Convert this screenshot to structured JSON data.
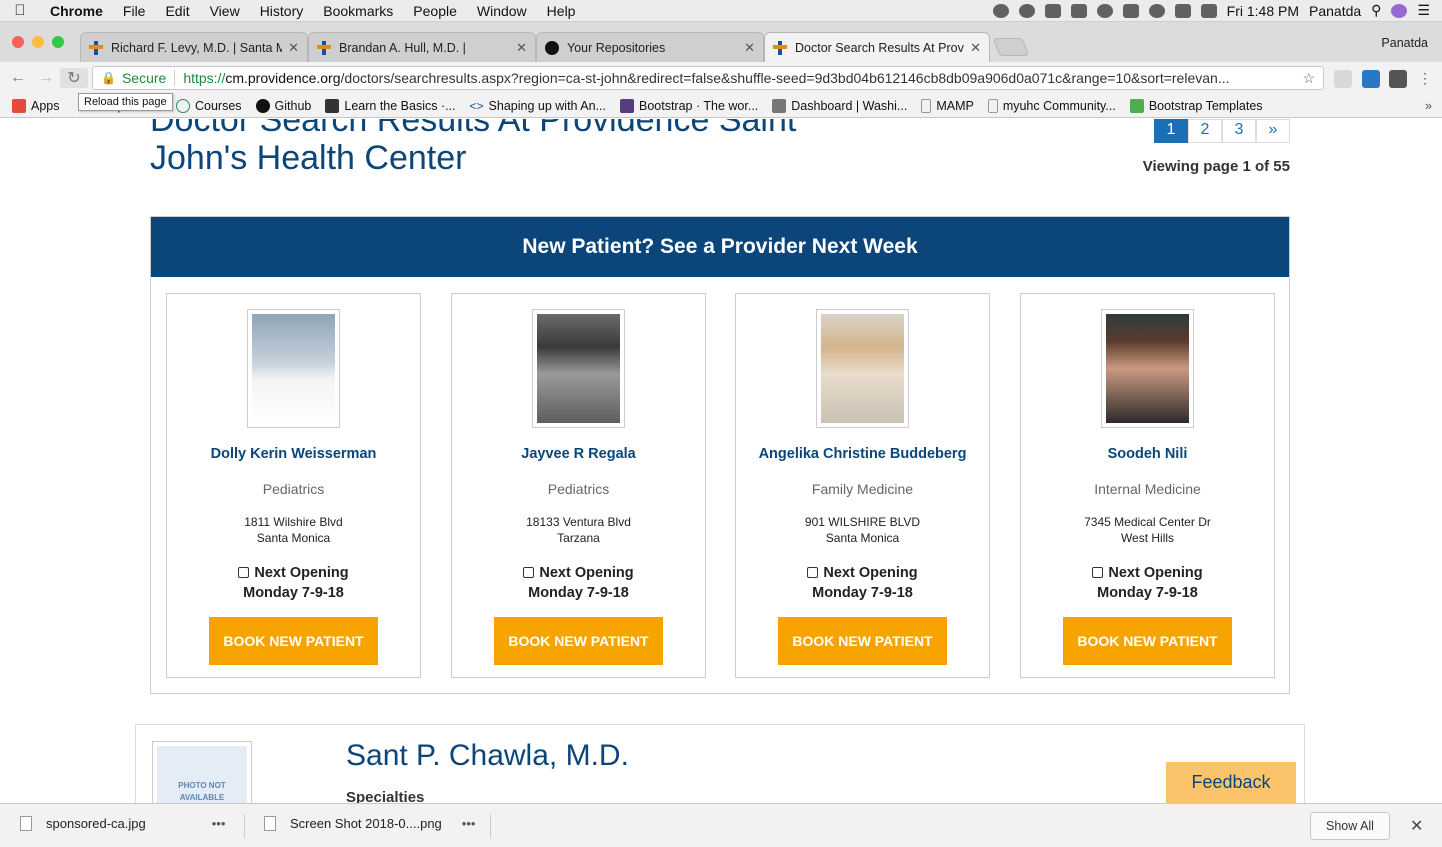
{
  "menubar": {
    "app": "Chrome",
    "items": [
      "File",
      "Edit",
      "View",
      "History",
      "Bookmarks",
      "People",
      "Window",
      "Help"
    ],
    "clock": "Fri 1:48 PM",
    "user": "Panatda"
  },
  "tabs": [
    {
      "title": "Richard F. Levy, M.D. | Santa M",
      "icon": "providence-icon"
    },
    {
      "title": "Brandan A. Hull, M.D. |",
      "icon": "providence-icon"
    },
    {
      "title": "Your Repositories",
      "icon": "github-icon"
    },
    {
      "title": "Doctor Search Results At Provi",
      "icon": "providence-icon"
    }
  ],
  "profile_name": "Panatda",
  "address": {
    "secure_label": "Secure",
    "scheme": "https://",
    "host": "cm.providence.org",
    "path": "/doctors/searchresults.aspx?region=ca-st-john&redirect=false&shuffle-seed=9d3bd04b612146cb8db09a906d0a071c&range=10&sort=relevan..."
  },
  "tooltip": "Reload this page",
  "bookmarks": [
    {
      "label": "Apps",
      "color": "#e34b3a"
    },
    {
      "label": "picenter",
      "color": "#2f77c7"
    },
    {
      "label": "Courses",
      "color": "#2a8d5b"
    },
    {
      "label": "Github",
      "color": "#111111"
    },
    {
      "label": "Learn the Basics ·...",
      "color": "#333333"
    },
    {
      "label": "Shaping up with An...",
      "color": "#1b4f9c"
    },
    {
      "label": "Bootstrap · The wor...",
      "color": "#563d7c"
    },
    {
      "label": "Dashboard | Washi...",
      "color": "#666666"
    },
    {
      "label": "MAMP",
      "color": "#999999"
    },
    {
      "label": "myuhc Community...",
      "color": "#999999"
    },
    {
      "label": "Bootstrap Templates",
      "color": "#4cae4c"
    }
  ],
  "page": {
    "heading_line1": "Doctor Search Results At Providence Saint",
    "heading_line2": "John's Health Center",
    "pager": [
      "1",
      "2",
      "3",
      "»"
    ],
    "viewing": "Viewing page 1 of 55",
    "promo_title": "New Patient? See a Provider Next Week",
    "providers": [
      {
        "name": "Dolly Kerin Weisserman",
        "specialty": "Pediatrics",
        "address1": "1811 Wilshire Blvd",
        "address2": "Santa Monica",
        "next_label": "Next Opening",
        "next_date": "Monday 7-9-18",
        "button": "BOOK NEW PATIENT"
      },
      {
        "name": "Jayvee R Regala",
        "specialty": "Pediatrics",
        "address1": "18133 Ventura Blvd",
        "address2": "Tarzana",
        "next_label": "Next Opening",
        "next_date": "Monday 7-9-18",
        "button": "BOOK NEW PATIENT"
      },
      {
        "name": "Angelika Christine Buddeberg",
        "specialty": "Family Medicine",
        "address1": "901 WILSHIRE BLVD",
        "address2": "Santa Monica",
        "next_label": "Next Opening",
        "next_date": "Monday 7-9-18",
        "button": "BOOK NEW PATIENT"
      },
      {
        "name": "Soodeh Nili",
        "specialty": "Internal Medicine",
        "address1": "7345 Medical Center Dr",
        "address2": "West Hills",
        "next_label": "Next Opening",
        "next_date": "Monday 7-9-18",
        "button": "BOOK NEW PATIENT"
      }
    ],
    "result": {
      "photo_text_line1": "PHOTO NOT",
      "photo_text_line2": "AVAILABLE",
      "name": "Sant P. Chawla, M.D.",
      "specialties_label": "Specialties"
    },
    "feedback": "Feedback"
  },
  "downloads": [
    {
      "file": "sponsored-ca.jpg"
    },
    {
      "file": "Screen Shot 2018-0....png"
    }
  ],
  "show_all": "Show All",
  "colors": {
    "brand_blue": "#0b4579",
    "accent_orange": "#f7a400",
    "link_blue": "#1a6fb5"
  }
}
